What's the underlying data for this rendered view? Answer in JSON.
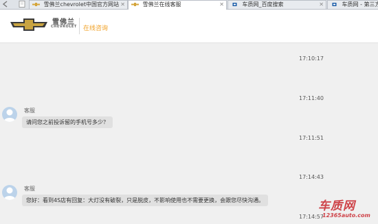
{
  "browser": {
    "tabs": [
      {
        "title": "雪佛兰chevrolet中国官方网站",
        "active": false
      },
      {
        "title": "雪佛兰在线客服",
        "active": true
      },
      {
        "title": "车质网_百度搜索",
        "active": false
      },
      {
        "title": "车质网 - 第三方",
        "active": false
      }
    ]
  },
  "header": {
    "brand_cn": "雪佛兰",
    "brand_en": "CHEVROLET",
    "page_label": "在线咨询"
  },
  "chat": {
    "timestamps": [
      "17:10:17",
      "17:11:40",
      "17:11:51",
      "17:14:43",
      "17:14:57"
    ],
    "messages": [
      {
        "sender": "客服",
        "text": "请问您之前投诉留的手机号多少？"
      },
      {
        "sender": "客服",
        "text": "您好：看到4S店有回复：大灯没有破裂，只是脱皮，不影响使用也不需要更换，会跟您尽快沟通。"
      }
    ]
  },
  "watermark": {
    "text_cn": "车质网",
    "text_en": "12365auto.com"
  },
  "colors": {
    "accent": "#f0a025",
    "bubble": "#e0e0e0",
    "avatar": "#bcd3ea",
    "watermark": "#c9252c"
  },
  "icons": {
    "tab_favicon": "chevrolet-bowtie-icon",
    "tab_favicon_alt": "chezhiwang-icon",
    "avatar": "user-avatar-icon",
    "back": "back-arrow-icon",
    "doc": "document-icon"
  }
}
